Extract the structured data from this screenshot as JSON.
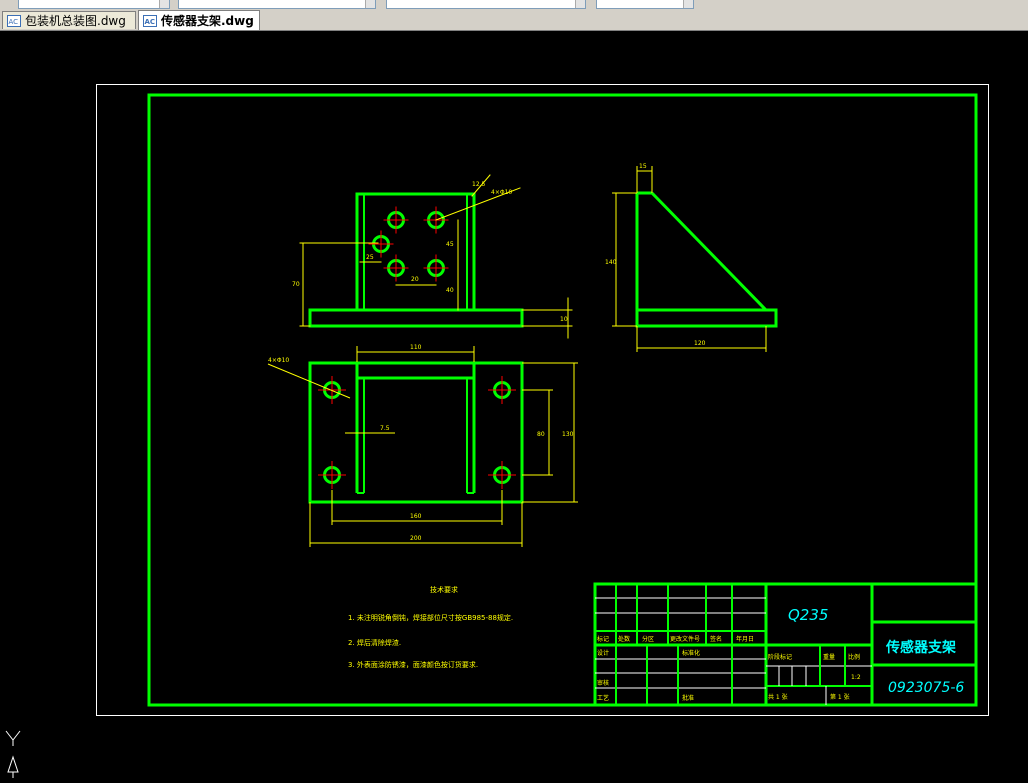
{
  "tabs": [
    {
      "label": "包装机总装图.dwg"
    },
    {
      "label": "传感器支架.dwg"
    }
  ],
  "drawing": {
    "material": "Q235",
    "part_name": "传感器支架",
    "drawing_number": "0923075-6",
    "scale": "1:2",
    "sheet_total": "共 1 张",
    "sheet_no": "第 1 张",
    "tech_req_title": "技术要求",
    "tech_req": [
      "1. 未注明锐角倒钝，焊接部位尺寸按GB985-88规定.",
      "2. 焊后清除焊渣.",
      "3. 外表面涂防锈漆，面漆颜色按订货要求."
    ],
    "dims": {
      "top_hole": "4×Φ10",
      "angle": "12.5",
      "d45": "45",
      "d40": "40",
      "d25": "25",
      "d20": "20",
      "d10": "10",
      "d70": "70",
      "d10b": "10",
      "side_15": "15",
      "side_120": "120",
      "side_140": "140",
      "plan_hole": "4×Φ10",
      "plan_110": "110",
      "plan_75": "7.5",
      "plan_80": "80",
      "plan_130": "130",
      "plan_160": "160",
      "plan_200": "200"
    },
    "title_block": {
      "mark": "标记",
      "count": "处数",
      "zone": "分区",
      "change_doc": "更改文件号",
      "signature": "签名",
      "date": "年月日",
      "designer": "设计",
      "standardize": "标准化",
      "review": "审核",
      "process": "工艺",
      "approve": "批准",
      "stage": "阶段标记",
      "weight": "重量",
      "ratio": "比例"
    }
  }
}
